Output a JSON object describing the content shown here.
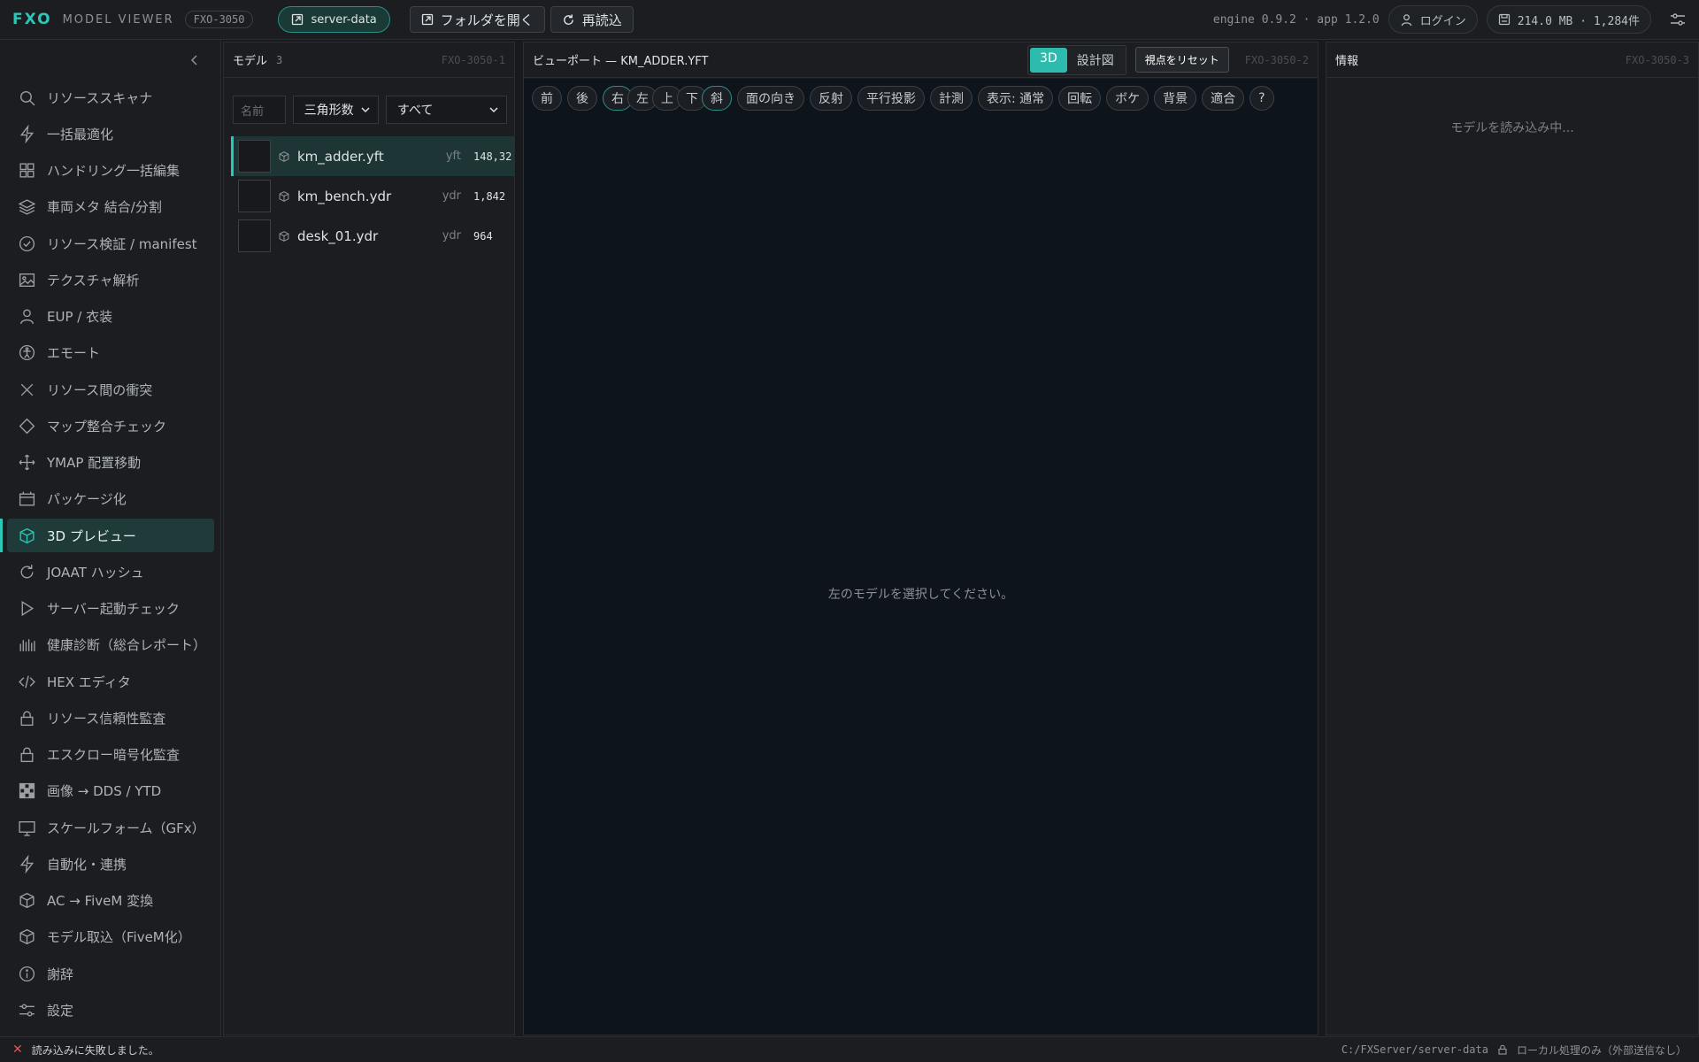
{
  "app": {
    "brand": "FXO",
    "name": "MODEL VIEWER",
    "id": "FXO-3050"
  },
  "toolbar": {
    "workspace": "server-data",
    "open_folder": "フォルダを開く",
    "reload": "再読込",
    "version": "engine 0.9.2 · app 1.2.0",
    "login": "ログイン",
    "memory": "214.0 MB · 1,284件"
  },
  "sidebar": {
    "items": [
      {
        "label": "リソーススキャナ",
        "icon": "search-icon"
      },
      {
        "label": "一括最適化",
        "icon": "bolt-icon"
      },
      {
        "label": "ハンドリング一括編集",
        "icon": "grid-icon"
      },
      {
        "label": "車両メタ 結合/分割",
        "icon": "layers-icon"
      },
      {
        "label": "リソース検証 / manifest",
        "icon": "check-circle-icon"
      },
      {
        "label": "テクスチャ解析",
        "icon": "image-icon"
      },
      {
        "label": "EUP / 衣装",
        "icon": "user-icon"
      },
      {
        "label": "エモート",
        "icon": "person-icon"
      },
      {
        "label": "リソース間の衝突",
        "icon": "x-icon"
      },
      {
        "label": "マップ整合チェック",
        "icon": "diamond-icon"
      },
      {
        "label": "YMAP 配置移動",
        "icon": "move-icon"
      },
      {
        "label": "パッケージ化",
        "icon": "package-icon"
      },
      {
        "label": "3D プレビュー",
        "icon": "cube-icon"
      },
      {
        "label": "JOAAT ハッシュ",
        "icon": "refresh-icon"
      },
      {
        "label": "サーバー起動チェック",
        "icon": "play-icon"
      },
      {
        "label": "健康診断（総合レポート）",
        "icon": "bars-icon"
      },
      {
        "label": "HEX エディタ",
        "icon": "code-icon"
      },
      {
        "label": "リソース信頼性監査",
        "icon": "lock-icon"
      },
      {
        "label": "エスクロー暗号化監査",
        "icon": "lock-icon"
      },
      {
        "label": "画像 → DDS / YTD",
        "icon": "checker-icon"
      },
      {
        "label": "スケールフォーム（GFx）",
        "icon": "monitor-icon"
      },
      {
        "label": "自動化・連携",
        "icon": "bolt-icon"
      },
      {
        "label": "AC → FiveM 変換",
        "icon": "cube-icon"
      },
      {
        "label": "モデル取込（FiveM化）",
        "icon": "cube-icon"
      },
      {
        "label": "謝辞",
        "icon": "info-icon"
      },
      {
        "label": "設定",
        "icon": "sliders-icon"
      }
    ],
    "active_index": 12
  },
  "models": {
    "title": "モデル",
    "count": "3",
    "panel_id": "FXO-3050-1",
    "name_placeholder": "名前",
    "sort": "三角形数",
    "filter": "すべて",
    "rows": [
      {
        "name": "km_adder.yft",
        "ext": "yft",
        "tris": "148,32"
      },
      {
        "name": "km_bench.ydr",
        "ext": "ydr",
        "tris": "1,842"
      },
      {
        "name": "desk_01.ydr",
        "ext": "ydr",
        "tris": "964"
      }
    ],
    "selected_index": 0
  },
  "viewport": {
    "title": "ビューポート — KM_ADDER.YFT",
    "mode_3d": "3D",
    "mode_blueprint": "設計図",
    "reset_view": "視点をリセット",
    "panel_id": "FXO-3050-2",
    "tools": [
      "前",
      "後",
      "右",
      "左",
      "上",
      "下",
      "斜",
      "面の向き",
      "反射",
      "平行投影",
      "計測",
      "表示: 通常",
      "回転",
      "ボケ",
      "背景",
      "適合",
      "?"
    ],
    "message": "左のモデルを選択してください。"
  },
  "info": {
    "title": "情報",
    "panel_id": "FXO-3050-3",
    "loading": "モデルを読み込み中..."
  },
  "status": {
    "error": "読み込みに失敗しました。",
    "path": "C:/FXServer/server-data",
    "privacy": "ローカル処理のみ（外部送信なし）"
  },
  "colors": {
    "accent": "#2cc7b7",
    "error": "#e05555",
    "viewport_bg": "#0e141c"
  }
}
